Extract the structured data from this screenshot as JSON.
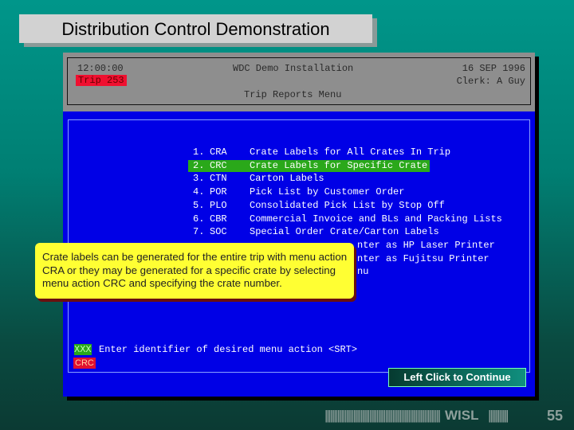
{
  "slide_title": "Distribution Control Demonstration",
  "header": {
    "time": "12:00:00",
    "trip": "Trip 253",
    "installation": "WDC Demo Installation",
    "date": "16 SEP 1996",
    "clerk": "Clerk: A Guy",
    "menu_title": "Trip Reports Menu"
  },
  "menu": [
    {
      "num": "1.",
      "code": "CRA",
      "label": "Crate Labels for All Crates In Trip"
    },
    {
      "num": "2.",
      "code": "CRC",
      "label": "Crate Labels for Specific Crate"
    },
    {
      "num": "3.",
      "code": "CTN",
      "label": "Carton Labels"
    },
    {
      "num": "4.",
      "code": "POR",
      "label": "Pick List by Customer Order"
    },
    {
      "num": "5.",
      "code": "PLO",
      "label": "Consolidated Pick List by Stop Off"
    },
    {
      "num": "6.",
      "code": "CBR",
      "label": "Commercial Invoice and BLs and Packing Lists"
    },
    {
      "num": "7.",
      "code": "SOC",
      "label": "Special Order Crate/Carton Labels"
    }
  ],
  "menu_partial": [
    "nter as HP Laser Printer",
    "nter as Fujitsu Printer",
    "nu"
  ],
  "tooltip": "Crate labels can be generated for the entire trip with menu action CRA or they may be generated for a specific crate by selecting menu action CRC and specifying the crate number.",
  "prompt": {
    "field": "XXX",
    "text": "Enter identifier of desired menu action <SRT>",
    "input_value": "CRC"
  },
  "continue_label": "Left Click to Continue",
  "footer": {
    "bars_left": "||||||||||||||||||||||||||||||||||||||||||||||||||||||||||||||||||||||||||||||||||||||||||||||||||||||||||||||||||||||||||||||||||||||",
    "brand": "WISL",
    "bars_right": "|||||||||||",
    "page": "55"
  }
}
